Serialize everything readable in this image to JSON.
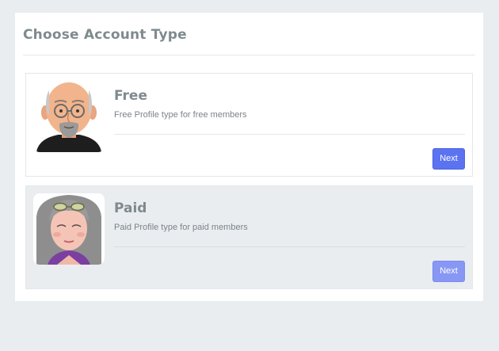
{
  "panel": {
    "title": "Choose Account Type"
  },
  "accounts": [
    {
      "name": "Free",
      "description": "Free Profile type for free members",
      "button_label": "Next",
      "avatar_icon": "bald-man-with-glasses-avatar"
    },
    {
      "name": "Paid",
      "description": "Paid Profile type for paid members",
      "button_label": "Next",
      "avatar_icon": "gray-haired-woman-with-glasses-avatar"
    }
  ],
  "colors": {
    "page_background": "#eaedef",
    "panel_background": "#ffffff",
    "heading_text": "#7f8a8f",
    "button_primary": "#5b73f0",
    "button_dimmed": "#8797f3"
  }
}
